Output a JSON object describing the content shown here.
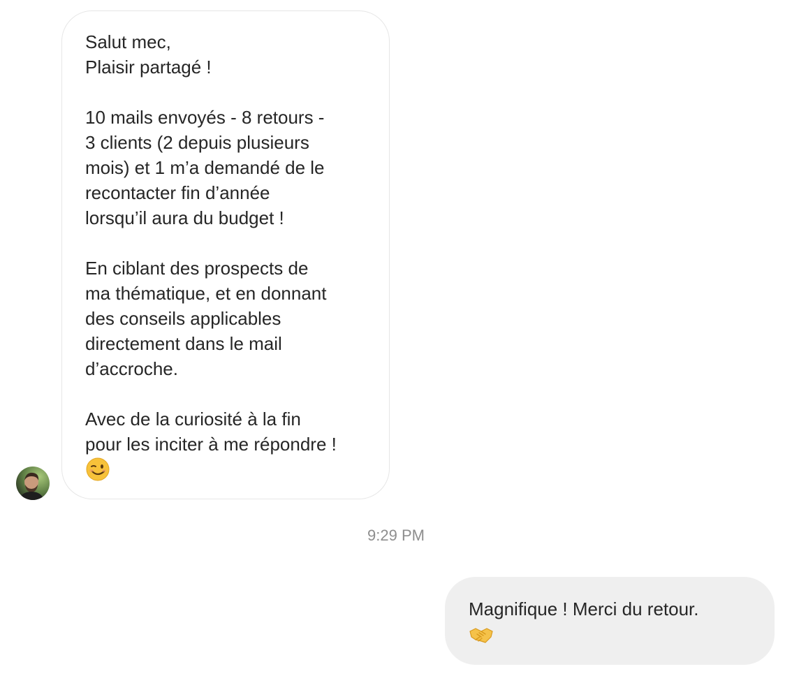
{
  "thread": {
    "incoming_message": {
      "lines": [
        "Salut mec,",
        "Plaisir partagé !",
        "",
        "10 mails envoyés - 8 retours -",
        "3 clients (2 depuis plusieurs",
        "mois) et 1 m’a demandé de le",
        "recontacter fin d’année",
        "lorsqu’il aura du budget !",
        "",
        "En ciblant des prospects de",
        "ma thématique, et en donnant",
        "des conseils applicables",
        "directement dans le mail",
        "d’accroche.",
        "",
        "Avec de la curiosité à la fin",
        "pour les inciter à me répondre !"
      ],
      "emoji": "winking-face"
    },
    "timestamp": "9:29 PM",
    "outgoing_message": {
      "lines": [
        "Magnifique ! Merci du retour."
      ],
      "emoji": "handshake"
    },
    "sender_avatar": "profile-photo"
  }
}
